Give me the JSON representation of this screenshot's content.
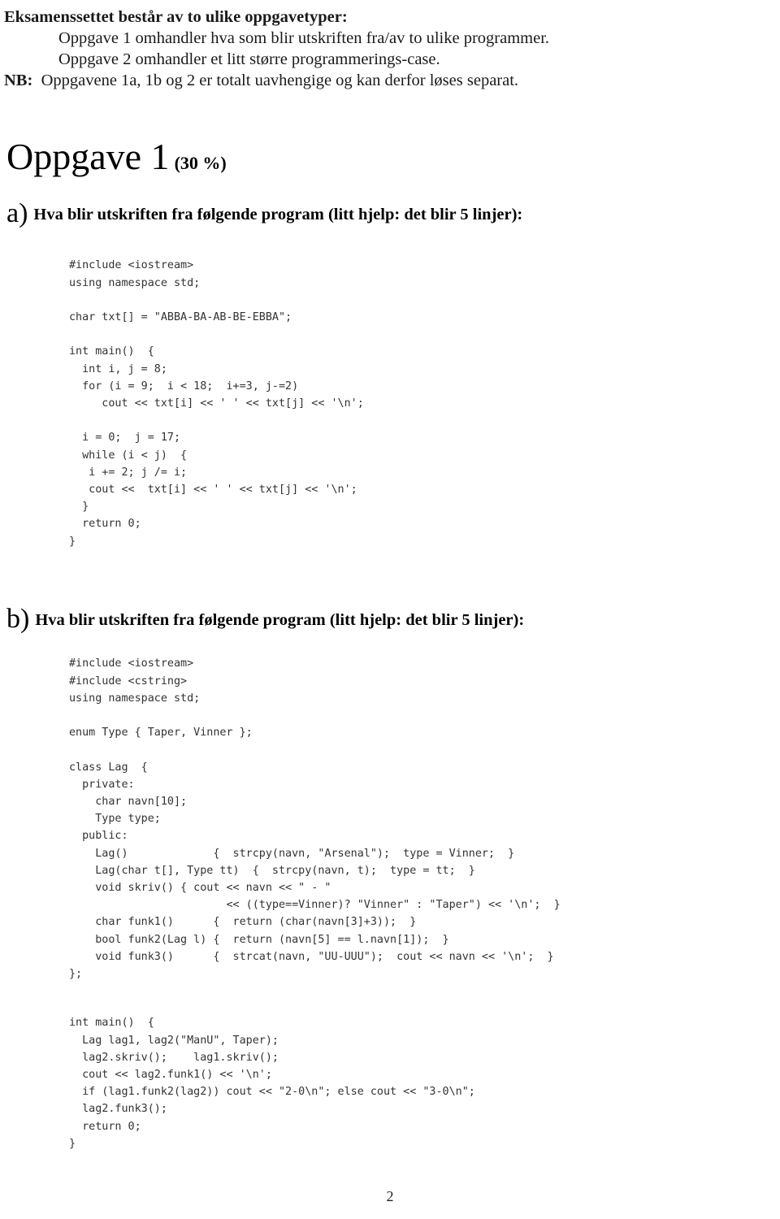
{
  "document": {
    "page_number": "2"
  },
  "intro": {
    "heading": "Eksamenssettet består av to ulike oppgavetyper:",
    "bullets": [
      "Oppgave 1 omhandler hva som blir utskriften fra/av to ulike programmer.",
      "Oppgave 2 omhandler et litt større programmerings-case."
    ],
    "nb_tag": "NB:",
    "nb_text": "Oppgavene 1a, 1b og 2 er totalt uavhengige og kan derfor løses separat."
  },
  "task": {
    "title": "Oppgave 1",
    "weight": "(30 %)"
  },
  "question_a": {
    "letter": "a)",
    "text": "Hva blir utskriften fra følgende program (litt hjelp: det blir 5 linjer):",
    "code": "#include <iostream>\nusing namespace std;\n\nchar txt[] = \"ABBA-BA-AB-BE-EBBA\";\n\nint main()  {\n  int i, j = 8;\n  for (i = 9;  i < 18;  i+=3, j-=2)\n     cout << txt[i] << ' ' << txt[j] << '\\n';\n\n  i = 0;  j = 17;\n  while (i < j)  {\n   i += 2; j /= i;\n   cout <<  txt[i] << ' ' << txt[j] << '\\n';\n  }\n  return 0;\n}"
  },
  "question_b": {
    "letter": "b)",
    "text": "Hva blir utskriften fra følgende program (litt hjelp: det blir 5 linjer):",
    "code_part1": "#include <iostream>\n#include <cstring>\nusing namespace std;\n\nenum Type { Taper, Vinner };\n\nclass Lag  {\n  private:\n    char navn[10];\n    Type type;\n  public:\n    Lag()             {  strcpy(navn, \"Arsenal\");  type = Vinner;  }\n    Lag(char t[], Type tt)  {  strcpy(navn, t);  type = tt;  }\n    void skriv() { cout << navn << \" - \"\n                        << ((type==Vinner)? \"Vinner\" : \"Taper\") << '\\n';  }\n    char funk1()      {  return (char(navn[3]+3));  }\n    bool funk2(Lag l) {  return (navn[5] == l.navn[1]);  }\n    void funk3()      {  strcat(navn, \"UU-UUU\");  cout << navn << '\\n';  }\n};",
    "code_part2": "int main()  {\n  Lag lag1, lag2(\"ManU\", Taper);\n  lag2.skriv();    lag1.skriv();\n  cout << lag2.funk1() << '\\n';\n  if (lag1.funk2(lag2)) cout << \"2-0\\n\"; else cout << \"3-0\\n\";\n  lag2.funk3();\n  return 0;\n}"
  }
}
